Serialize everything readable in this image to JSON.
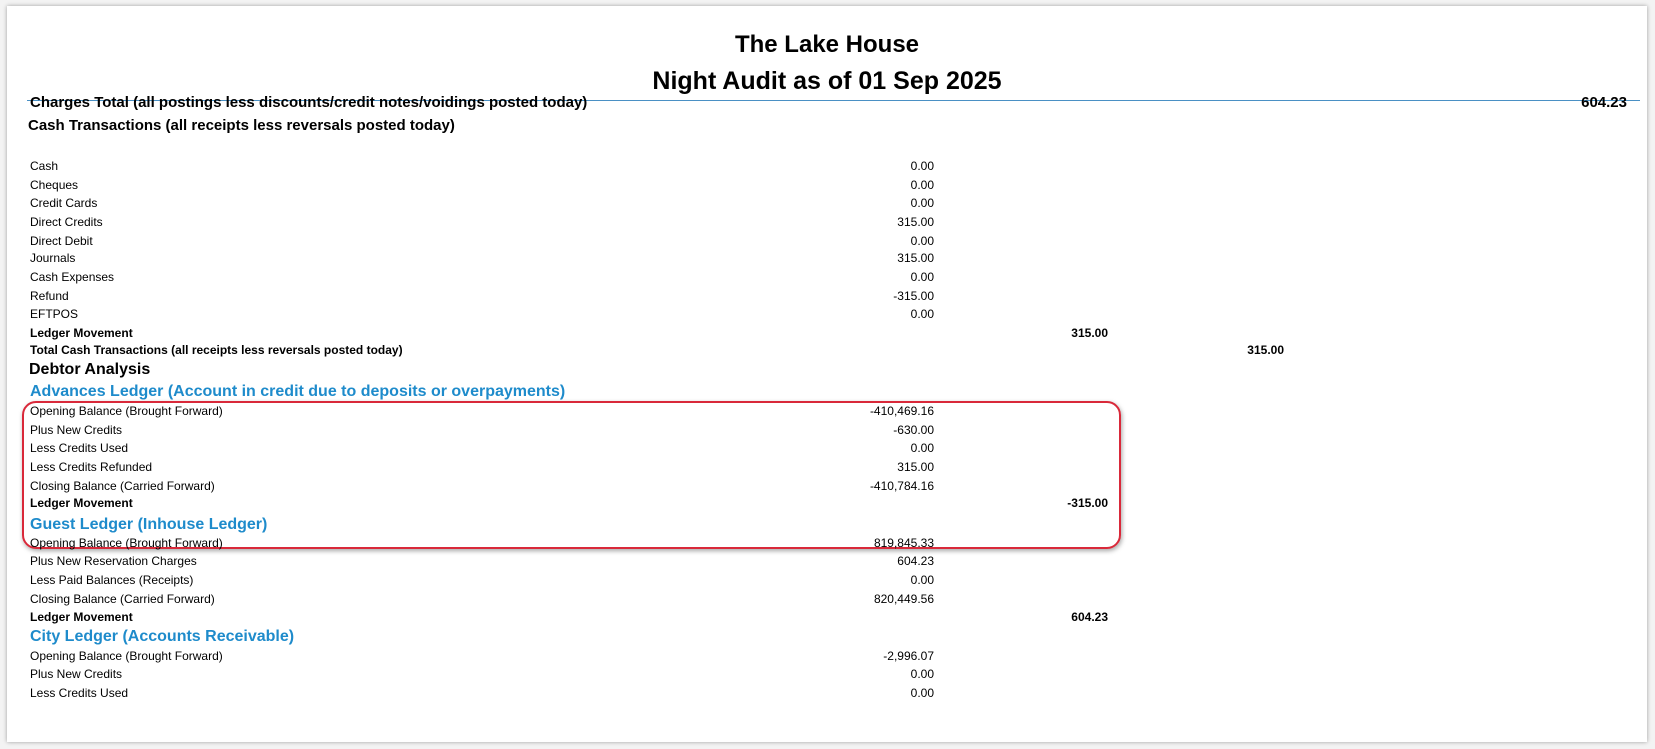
{
  "header": {
    "hotel_name": "The Lake House",
    "report_title": "Night Audit as of 01 Sep 2025"
  },
  "charges": {
    "label": "Charges Total (all postings less discounts/credit notes/voidings posted today)",
    "total": "604.23"
  },
  "cash": {
    "heading": "Cash Transactions (all receipts less reversals posted today)",
    "rows": [
      {
        "label": "Cash",
        "value": "0.00"
      },
      {
        "label": "Cheques",
        "value": "0.00"
      },
      {
        "label": "Credit Cards",
        "value": "0.00"
      },
      {
        "label": "Direct Credits",
        "value": "315.00"
      },
      {
        "label": "Direct Debit",
        "value": "0.00"
      },
      {
        "label": "Journals",
        "value": "315.00"
      },
      {
        "label": "Cash Expenses",
        "value": "0.00"
      },
      {
        "label": "Refund",
        "value": "-315.00"
      },
      {
        "label": "EFTPOS",
        "value": "0.00"
      }
    ],
    "movement_label": "Ledger Movement",
    "movement_value": "315.00",
    "total_label": "Total Cash Transactions (all receipts less reversals posted today)",
    "total_value": "315.00"
  },
  "debtor": {
    "heading": "Debtor Analysis",
    "advances": {
      "title": "Advances Ledger (Account in credit due to deposits or overpayments)",
      "rows": [
        {
          "label": "Opening Balance (Brought Forward)",
          "value": "-410,469.16"
        },
        {
          "label": "Plus New Credits",
          "value": "-630.00"
        },
        {
          "label": "Less Credits Used",
          "value": "0.00"
        },
        {
          "label": "Less Credits Refunded",
          "value": "315.00"
        },
        {
          "label": "Closing Balance (Carried Forward)",
          "value": "-410,784.16"
        }
      ],
      "movement_label": "Ledger Movement",
      "movement_value": "-315.00"
    },
    "guest": {
      "title": "Guest Ledger (Inhouse Ledger)",
      "rows": [
        {
          "label": "Opening Balance (Brought Forward)",
          "value": "819,845.33"
        },
        {
          "label": "Plus New Reservation Charges",
          "value": "604.23"
        },
        {
          "label": "Less Paid Balances (Receipts)",
          "value": "0.00"
        },
        {
          "label": "Closing Balance (Carried Forward)",
          "value": "820,449.56"
        }
      ],
      "movement_label": "Ledger Movement",
      "movement_value": "604.23"
    },
    "city": {
      "title": "City Ledger (Accounts Receivable)",
      "rows": [
        {
          "label": "Opening Balance (Brought Forward)",
          "value": "-2,996.07"
        },
        {
          "label": "Plus New Credits",
          "value": "0.00"
        },
        {
          "label": "Less Credits Used",
          "value": "0.00"
        }
      ]
    }
  },
  "colors": {
    "accent_blue": "#1e8bcb",
    "highlight_red": "#d9293a"
  }
}
